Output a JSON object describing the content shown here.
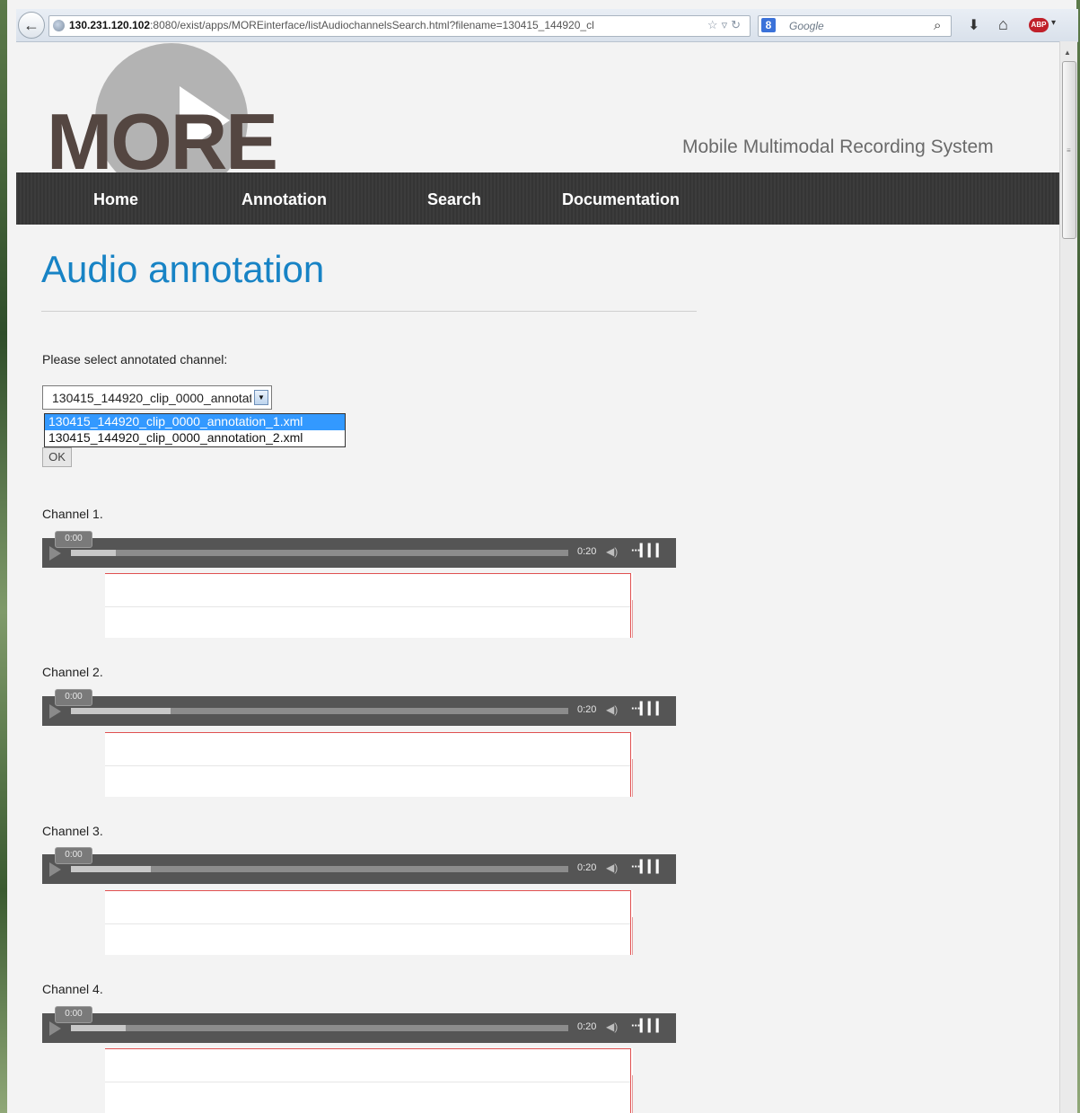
{
  "browser": {
    "url_host": "130.231.120.102",
    "url_rest": ":8080/exist/apps/MOREinterface/listAudiochannelsSearch.html?filename=130415_144920_cl",
    "search_placeholder": "Google",
    "search_engine_icon": "8",
    "abp_label": "ABP"
  },
  "header": {
    "logo_text": "MORE",
    "tagline": "Mobile Multimodal Recording System"
  },
  "nav": {
    "items": [
      "Home",
      "Annotation",
      "Search",
      "Documentation"
    ]
  },
  "main": {
    "title": "Audio annotation",
    "select_label": "Please select annotated channel:",
    "select_value": "130415_144920_clip_0000_annotation_1.xml",
    "options": [
      "130415_144920_clip_0000_annotation_1.xml",
      "130415_144920_clip_0000_annotation_2.xml"
    ],
    "ok_label": "OK"
  },
  "channels": [
    {
      "label": "Channel 1.",
      "current_time": "0:00",
      "duration": "0:20",
      "buffered": 0.09
    },
    {
      "label": "Channel 2.",
      "current_time": "0:00",
      "duration": "0:20",
      "buffered": 0.2
    },
    {
      "label": "Channel 3.",
      "current_time": "0:00",
      "duration": "0:20",
      "buffered": 0.16
    },
    {
      "label": "Channel 4.",
      "current_time": "0:00",
      "duration": "0:20",
      "buffered": 0.11
    }
  ],
  "colors": {
    "title_blue": "#1783c5",
    "navbar_dark": "#3a3a3a",
    "logo_brown": "#544641",
    "wave_red": "#e05050",
    "dropdown_selected": "#3399ff"
  }
}
